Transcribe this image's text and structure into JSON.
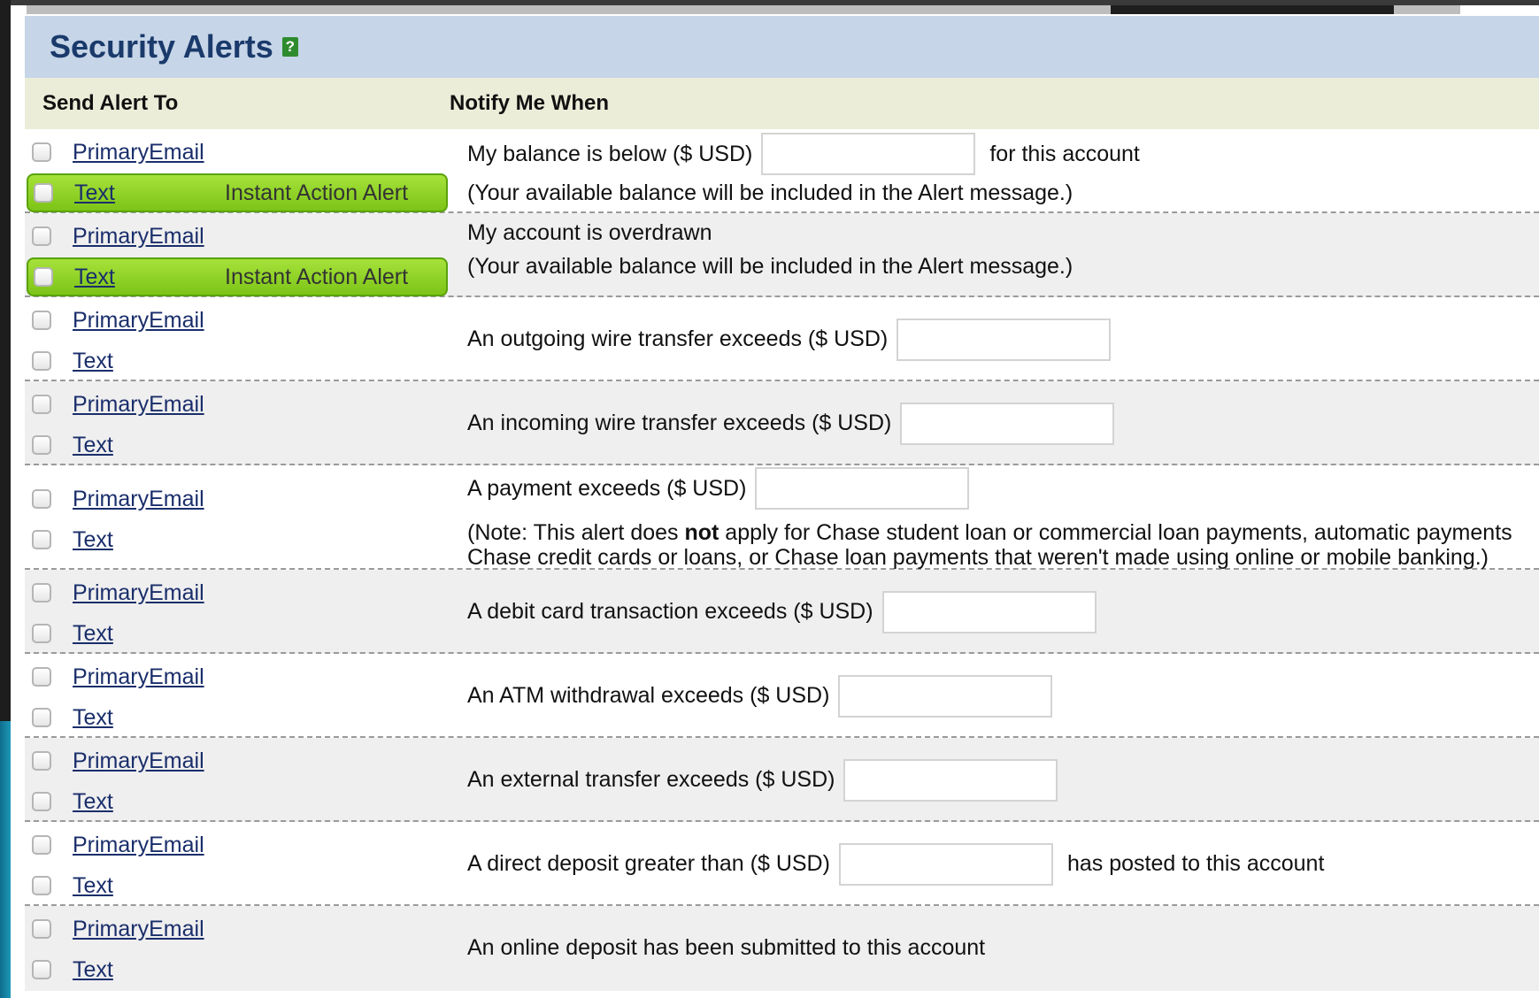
{
  "title": "Security Alerts",
  "help_icon": "?",
  "headers": {
    "send_to": "Send Alert To",
    "notify_when": "Notify Me When"
  },
  "channels": {
    "email": "PrimaryEmail",
    "text": "Text",
    "instant": "Instant Action Alert"
  },
  "alerts": [
    {
      "label": "My balance is below ($ USD)",
      "after": "for this account",
      "note": "(Your available balance will be included in the Alert message.)",
      "amount": "",
      "instant": true
    },
    {
      "label": "My account is overdrawn",
      "note": "(Your available balance will be included in the Alert message.)",
      "instant": true
    },
    {
      "label": "An outgoing wire transfer exceeds ($ USD)",
      "amount": ""
    },
    {
      "label": "An incoming wire transfer exceeds ($ USD)",
      "amount": ""
    },
    {
      "label": "A payment exceeds ($ USD)",
      "amount": "",
      "note_before": "(Note: This alert does ",
      "note_bold": "not",
      "note_after": " apply for Chase student loan or commercial loan payments, automatic payments",
      "note_line2": "Chase credit cards or loans, or Chase loan payments that weren't made using online or mobile banking.)"
    },
    {
      "label": "A debit card transaction exceeds ($ USD)",
      "amount": ""
    },
    {
      "label": "An ATM withdrawal exceeds ($ USD)",
      "amount": ""
    },
    {
      "label": "An external transfer exceeds ($ USD)",
      "amount": ""
    },
    {
      "label": "A direct deposit greater than ($ USD)",
      "after": "has posted to this account",
      "amount": ""
    },
    {
      "label": "An online deposit has been submitted to this account"
    }
  ]
}
